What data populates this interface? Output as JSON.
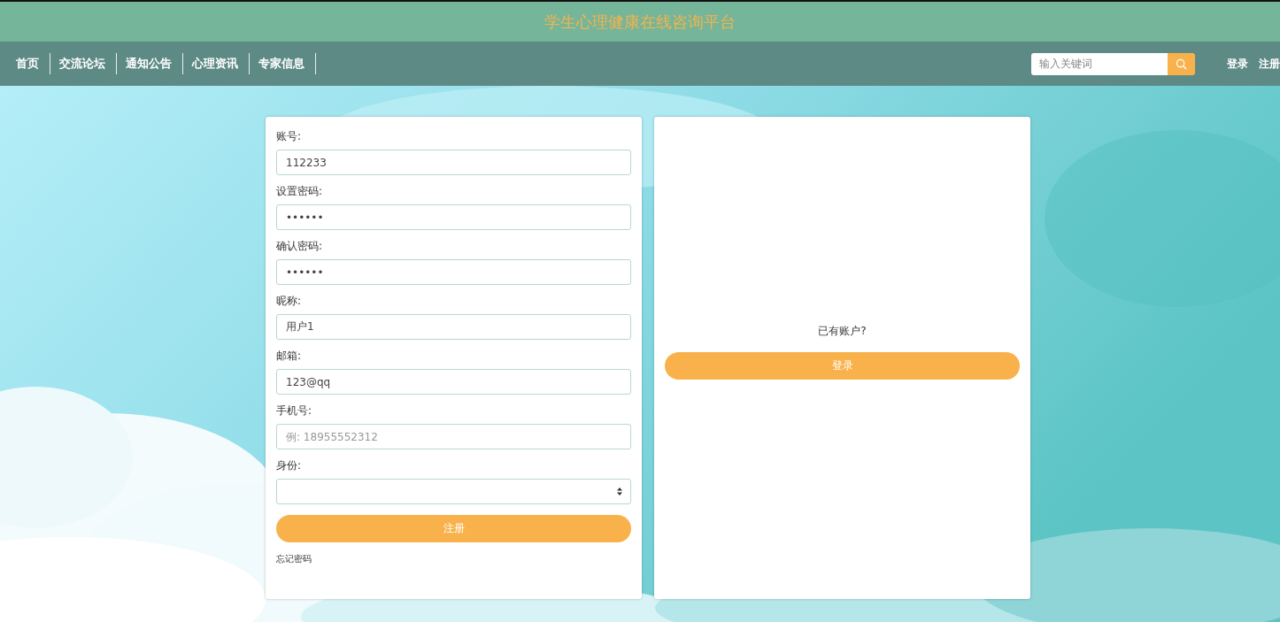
{
  "header": {
    "title": "学生心理健康在线咨询平台"
  },
  "nav": {
    "items": [
      "首页",
      "交流论坛",
      "通知公告",
      "心理资讯",
      "专家信息"
    ],
    "search": {
      "placeholder": "输入关键词"
    },
    "auth_links": [
      "登录",
      "注册"
    ]
  },
  "register_form": {
    "fields": [
      {
        "kind": "text",
        "label": "账号:",
        "value": "112233"
      },
      {
        "kind": "text",
        "label": "设置密码:",
        "value": "••••••"
      },
      {
        "kind": "text",
        "label": "确认密码:",
        "value": "••••••"
      },
      {
        "kind": "text",
        "label": "昵称:",
        "value": "用户1"
      },
      {
        "kind": "text",
        "label": "邮箱:",
        "value": "123@qq"
      },
      {
        "kind": "text",
        "label": "手机号:",
        "placeholder": "例: 18955552312"
      },
      {
        "kind": "select",
        "label": "身份:"
      }
    ],
    "submit": "注册",
    "forgot_link": "忘记密码"
  },
  "login_panel": {
    "prompt": "已有账户?",
    "button": "登录"
  }
}
